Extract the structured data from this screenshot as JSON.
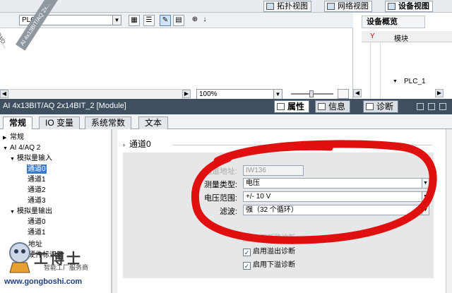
{
  "view_tabs": [
    {
      "label": "拓扑视图",
      "active": false
    },
    {
      "label": "网络视图",
      "active": false
    },
    {
      "label": "设备视图",
      "active": true
    }
  ],
  "device_view": {
    "device_select": "PLC_1",
    "module_label": "AI 4x13BIT/AQ 2x...",
    "partial_label": "PWD...",
    "zoom": "100%"
  },
  "overview": {
    "title": "设备概览",
    "column_module": "模块",
    "row_name": "PLC_1"
  },
  "inspector": {
    "title": "AI 4x13BIT/AQ 2x14BIT_2 [Module]",
    "tabs": [
      {
        "label": "属性",
        "active": true,
        "icon": "properties-icon"
      },
      {
        "label": "信息",
        "active": false,
        "icon": "info-icon"
      },
      {
        "label": "诊断",
        "active": false,
        "icon": "diagnostics-icon"
      }
    ]
  },
  "property_tabs": [
    "常规",
    "IO 变量",
    "系统常数",
    "文本"
  ],
  "tree": {
    "general": "常规",
    "module": "AI 4/AQ 2",
    "analog_input": "模拟量输入",
    "ai_channels": [
      "通道0",
      "通道1",
      "通道2",
      "通道3"
    ],
    "analog_output": "模拟量输出",
    "ao_channels": [
      "通道0",
      "通道1"
    ],
    "address": "地址",
    "hw_id": "硬件标识符"
  },
  "channel": {
    "section_title": "通道0",
    "address_label": "通道地址:",
    "address_value": "IW136",
    "measure_type_label": "测量类型:",
    "measure_type_value": "电压",
    "voltage_range_label": "电压范围:",
    "voltage_range_value": "+/- 10 V",
    "filter_label": "滤波:",
    "filter_value": "强（32 个循环）",
    "wire_break_label": "启用断路诊断",
    "overflow_label": "启用溢出诊断",
    "underflow_label": "启用下溢诊断",
    "wire_break_checked": false,
    "overflow_checked": true,
    "underflow_checked": true
  },
  "watermark": {
    "brand": "工博士",
    "subtitle": "智能工厂服务商",
    "url": "www.gongboshi.com"
  },
  "colors": {
    "inspector_bar": "#3f4f5f",
    "selection": "#3a78c8",
    "annotation_red": "#e01010",
    "panel_gray": "#e6e7e8"
  }
}
